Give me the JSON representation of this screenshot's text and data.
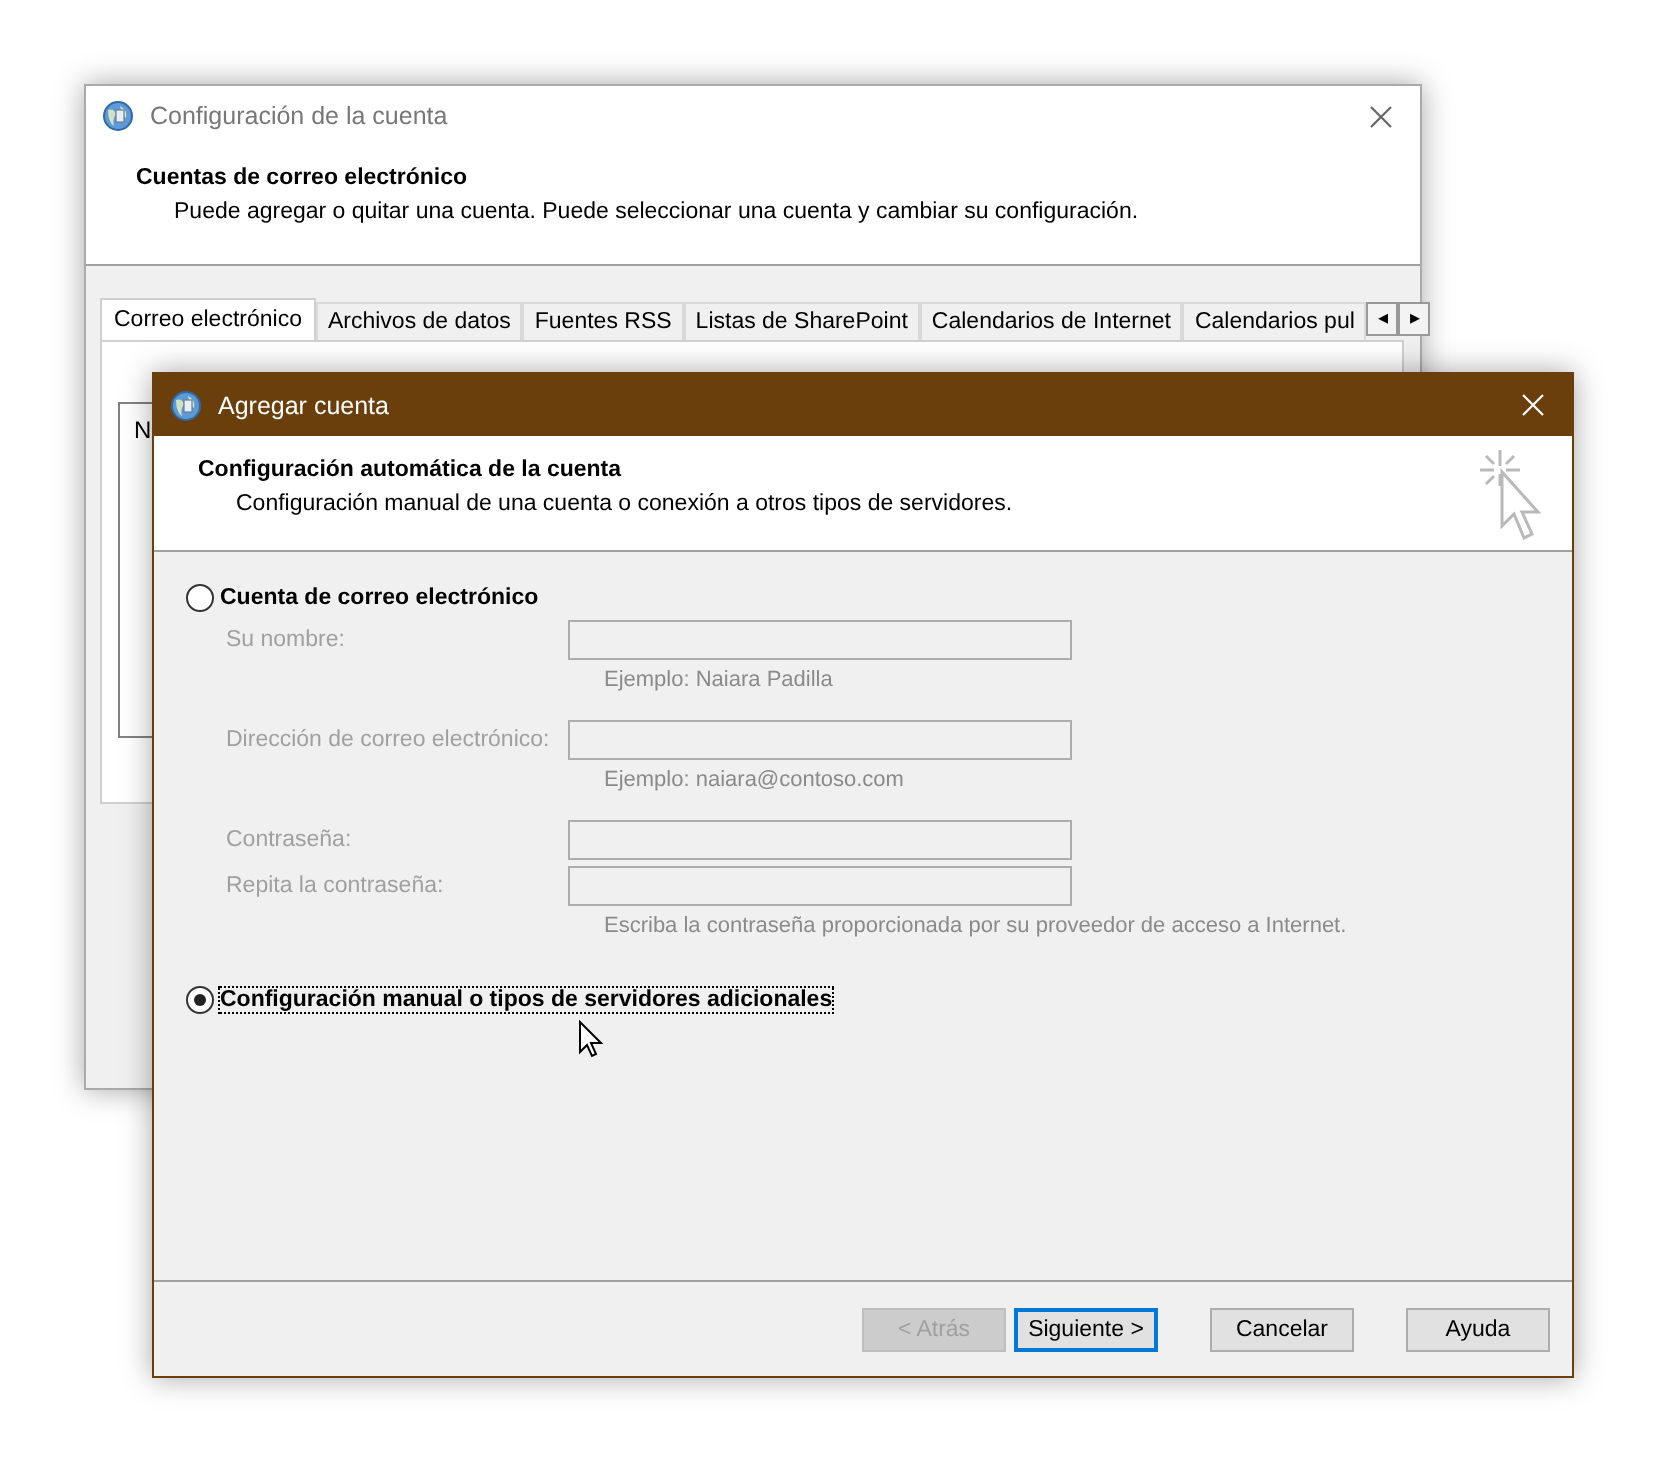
{
  "back_window": {
    "title": "Configuración de la cuenta",
    "heading": "Cuentas de correo electrónico",
    "description": "Puede agregar o quitar una cuenta. Puede seleccionar una cuenta y cambiar su configuración.",
    "tabs": [
      {
        "label": "Correo electrónico",
        "selected": true
      },
      {
        "label": "Archivos de datos",
        "selected": false
      },
      {
        "label": "Fuentes RSS",
        "selected": false
      },
      {
        "label": "Listas de SharePoint",
        "selected": false
      },
      {
        "label": "Calendarios de Internet",
        "selected": false
      },
      {
        "label": "Calendarios pul",
        "selected": false
      }
    ],
    "tab_scroll": [
      "◂",
      "▸"
    ],
    "list_text": "N"
  },
  "dialog": {
    "title": "Agregar cuenta",
    "heading": "Configuración automática de la cuenta",
    "description": "Configuración manual de una cuenta o conexión a otros tipos de servidores.",
    "options": [
      {
        "label": "Cuenta de correo electrónico",
        "selected": false
      },
      {
        "label": "Configuración manual o tipos de servidores adicionales",
        "selected": true
      }
    ],
    "fields": [
      {
        "label": "Su nombre:",
        "disabled": true,
        "hint": "Ejemplo: Naiara Padilla"
      },
      {
        "label": "Dirección de correo electrónico:",
        "disabled": true,
        "hint": "Ejemplo: naiara@contoso.com"
      },
      {
        "label": "Contraseña:",
        "disabled": true
      },
      {
        "label": "Repita la contraseña:",
        "disabled": true,
        "hint": "Escriba la contraseña proporcionada por su proveedor de acceso a Internet."
      }
    ],
    "buttons": [
      {
        "label": "< Atrás",
        "disabled": true,
        "default": false
      },
      {
        "label": "Siguiente >",
        "disabled": false,
        "default": true
      },
      {
        "label": "Cancelar",
        "disabled": false,
        "default": false
      },
      {
        "label": "Ayuda",
        "disabled": false,
        "default": false
      }
    ]
  }
}
